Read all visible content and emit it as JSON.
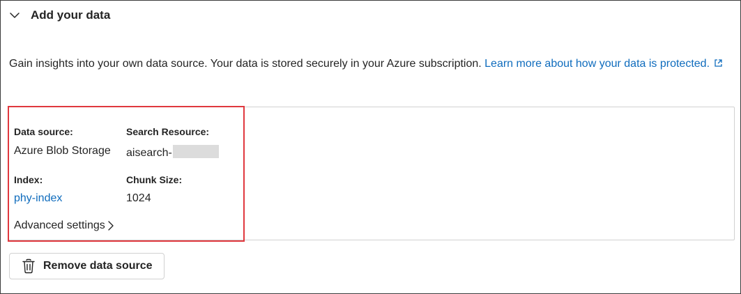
{
  "section": {
    "title": "Add your data",
    "expanded": true
  },
  "description": {
    "text": "Gain insights into your own data source. Your data is stored securely in your Azure subscription. ",
    "link_text": "Learn more about how your data is protected.",
    "link_icon": "external-link-icon"
  },
  "data_card": {
    "data_source_label": "Data source:",
    "data_source_value": "Azure Blob Storage",
    "search_resource_label": "Search Resource:",
    "search_resource_value": "aisearch-",
    "index_label": "Index:",
    "index_value": "phy-index",
    "chunk_size_label": "Chunk Size:",
    "chunk_size_value": "1024",
    "advanced_settings_label": "Advanced settings"
  },
  "remove_button": {
    "label": "Remove data source",
    "icon": "trash-icon"
  },
  "colors": {
    "link": "#0f6cbd",
    "highlight_border": "#e0383e",
    "text": "#242424"
  }
}
